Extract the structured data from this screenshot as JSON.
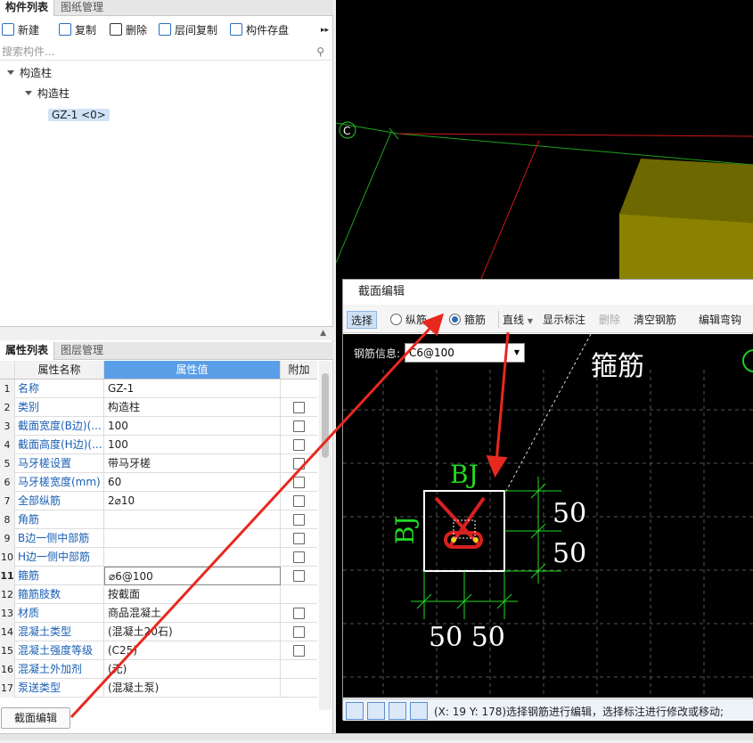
{
  "component_panel": {
    "tabs": [
      {
        "label": "构件列表"
      },
      {
        "label": "图纸管理"
      }
    ],
    "toolbar": [
      {
        "label": "新建",
        "icon": "new-icon"
      },
      {
        "label": "复制",
        "icon": "copy-icon"
      },
      {
        "label": "删除",
        "icon": "delete-icon"
      },
      {
        "label": "层间复制",
        "icon": "layer-copy-icon"
      },
      {
        "label": "构件存盘",
        "icon": "save-component-icon"
      }
    ],
    "search_placeholder": "搜索构件...",
    "tree": [
      {
        "label": "构造柱"
      },
      {
        "label": "构造柱"
      },
      {
        "label": "GZ-1 <0>"
      }
    ]
  },
  "property_panel": {
    "tabs": [
      {
        "label": "属性列表"
      },
      {
        "label": "图层管理"
      }
    ],
    "headers": {
      "name": "属性名称",
      "value": "属性值",
      "extra": "附加"
    },
    "rows": [
      {
        "n": "1",
        "name": "名称",
        "value": "GZ-1",
        "checkbox": false
      },
      {
        "n": "2",
        "name": "类别",
        "value": "构造柱",
        "checkbox": true
      },
      {
        "n": "3",
        "name": "截面宽度(B边)(...",
        "value": "100",
        "checkbox": true
      },
      {
        "n": "4",
        "name": "截面高度(H边)(...",
        "value": "100",
        "checkbox": true
      },
      {
        "n": "5",
        "name": "马牙槎设置",
        "value": "带马牙槎",
        "checkbox": true
      },
      {
        "n": "6",
        "name": "马牙槎宽度(mm)",
        "value": "60",
        "checkbox": true
      },
      {
        "n": "7",
        "name": "全部纵筋",
        "value": "2⌀10",
        "checkbox": true
      },
      {
        "n": "8",
        "name": "角筋",
        "value": "",
        "checkbox": true
      },
      {
        "n": "9",
        "name": "B边一侧中部筋",
        "value": "",
        "checkbox": true
      },
      {
        "n": "10",
        "name": "H边一侧中部筋",
        "value": "",
        "checkbox": true
      },
      {
        "n": "11",
        "name": "箍筋",
        "value": "⌀6@100",
        "checkbox": true
      },
      {
        "n": "12",
        "name": "箍筋肢数",
        "value": "按截面",
        "checkbox": false
      },
      {
        "n": "13",
        "name": "材质",
        "value": "商品混凝土",
        "checkbox": true
      },
      {
        "n": "14",
        "name": "混凝土类型",
        "value": "(混凝土20石)",
        "checkbox": true
      },
      {
        "n": "15",
        "name": "混凝土强度等级",
        "value": "(C25)",
        "checkbox": true
      },
      {
        "n": "16",
        "name": "混凝土外加剂",
        "value": "(无)",
        "checkbox": false
      },
      {
        "n": "17",
        "name": "泵送类型",
        "value": "(混凝土泵)",
        "checkbox": false
      }
    ],
    "bottom_button": "截面编辑"
  },
  "canvas": {
    "axis_label": "C"
  },
  "dialog": {
    "title": "截面编辑",
    "toolbar": {
      "select": "选择",
      "longitudinal": "纵筋",
      "stirrup": "箍筋",
      "line": "直线",
      "show_labels": "显示标注",
      "delete": "删除",
      "clear_rebar": "清空钢筋",
      "edit_hook": "编辑弯钩"
    },
    "rebar_info_label": "钢筋信息:",
    "rebar_info_value": "C6@100",
    "drawing": {
      "stirrup_label": "箍筋",
      "top_label": "BJ",
      "left_label": "BJ",
      "dim_right_top": "50",
      "dim_right_bottom": "50",
      "dim_bottom": "50 50"
    },
    "status_text": "(X: 19 Y: 178)选择钢筋进行编辑，选择标注进行修改或移动;"
  },
  "colors": {
    "annotation": "#e8281e",
    "green": "#22dd22",
    "olive": "#7a7200"
  }
}
